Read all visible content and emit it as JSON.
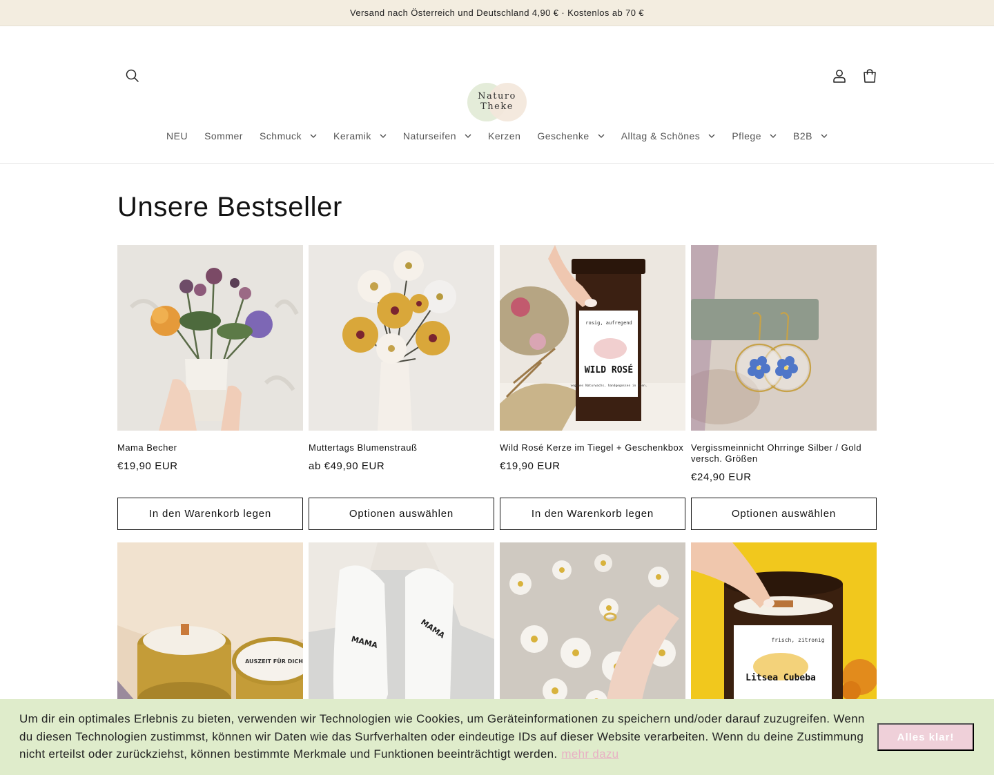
{
  "announcement": {
    "text": "Versand nach Österreich und Deutschland 4,90 € · Kostenlos ab 70 €"
  },
  "header": {
    "logo": {
      "line1": "Naturo",
      "line2": "Theke"
    }
  },
  "nav": {
    "items": [
      {
        "label": "NEU",
        "dropdown": false
      },
      {
        "label": "Sommer",
        "dropdown": false
      },
      {
        "label": "Schmuck",
        "dropdown": true
      },
      {
        "label": "Keramik",
        "dropdown": true
      },
      {
        "label": "Naturseifen",
        "dropdown": true
      },
      {
        "label": "Kerzen",
        "dropdown": false
      },
      {
        "label": "Geschenke",
        "dropdown": true
      },
      {
        "label": "Alltag & Schönes",
        "dropdown": true
      },
      {
        "label": "Pflege",
        "dropdown": true
      },
      {
        "label": "B2B",
        "dropdown": true
      }
    ]
  },
  "main": {
    "title": "Unsere Bestseller",
    "products": [
      {
        "title": "Mama Becher",
        "price": "€19,90 EUR",
        "cta": "In den Warenkorb legen"
      },
      {
        "title": "Muttertags Blumenstrauß",
        "price": "ab €49,90 EUR",
        "cta": "Optionen auswählen"
      },
      {
        "title": "Wild Rosé Kerze im Tiegel + Geschenkbox",
        "price": "€19,90 EUR",
        "cta": "In den Warenkorb legen"
      },
      {
        "title": "Vergissmeinnicht Ohrringe Silber / Gold versch. Größen",
        "price": "€24,90 EUR",
        "cta": "Optionen auswählen"
      }
    ],
    "row2_labels": {
      "tin_lid": "AUSZEIT FÜR DICH",
      "sock_left": "MAMA",
      "sock_right": "MAMA",
      "jar_top": "frisch, zitronig",
      "jar_name": "Litsea Cubeba"
    },
    "row1_labels": {
      "jar_top": "rosig, aufregend",
      "jar_name": "WILD ROSÉ",
      "jar_sub": "veganes Naturwachs, handgegossen in Wien."
    }
  },
  "cookie": {
    "text": "Um dir ein optimales Erlebnis zu bieten, verwenden wir Technologien wie Cookies, um Geräteinformationen zu speichern und/oder darauf zuzugreifen. Wenn du diesen Technologien zustimmst, können wir Daten wie das Surfverhalten oder eindeutige IDs auf dieser Website verarbeiten. Wenn du deine Zustimmung nicht erteilst oder zurückziehst, können bestimmte Merkmale und Funktionen beeinträchtigt werden.",
    "link": "mehr dazu",
    "button": "Alles klar!"
  },
  "colors": {
    "announcement_bg": "#f3ede0",
    "cookie_bg": "#dfeccb",
    "cookie_button": "#efd0d9",
    "cookie_link": "#e8b0c4"
  }
}
